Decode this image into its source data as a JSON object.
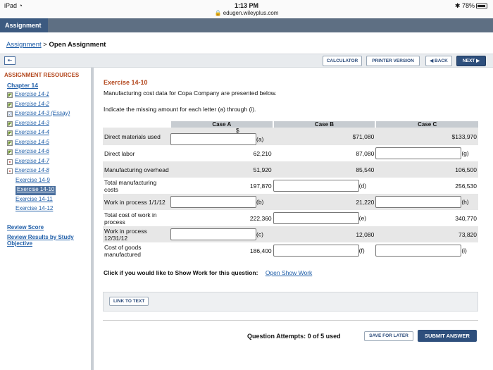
{
  "status_bar": {
    "device": "iPad",
    "wifi_icon": "wifi-icon",
    "time": "1:13 PM",
    "url": "edugen.wileyplus.com",
    "battery": "78%"
  },
  "tabs": {
    "active": "Assignment"
  },
  "breadcrumb": {
    "link": "Assignment",
    "separator": ">",
    "current": "Open Assignment"
  },
  "toolbar": {
    "calculator": "CALCULATOR",
    "printer": "PRINTER VERSION",
    "back": "◀ BACK",
    "next": "NEXT ▶"
  },
  "sidebar": {
    "header": "ASSIGNMENT RESOURCES",
    "chapter": "Chapter 14",
    "items": [
      {
        "label": "Exercise 14-1",
        "status": "partial"
      },
      {
        "label": "Exercise 14-2",
        "status": "partial"
      },
      {
        "label": "Exercise 14-3 (Essay)",
        "status": "checked"
      },
      {
        "label": "Exercise 14-3",
        "status": "partial"
      },
      {
        "label": "Exercise 14-4",
        "status": "partial"
      },
      {
        "label": "Exercise 14-5",
        "status": "partial"
      },
      {
        "label": "Exercise 14-6",
        "status": "partial"
      },
      {
        "label": "Exercise 14-7",
        "status": "wrong"
      },
      {
        "label": "Exercise 14-8",
        "status": "wrong"
      },
      {
        "label": "Exercise 14-9",
        "status": "none"
      },
      {
        "label": "Exercise 14-10",
        "status": "current"
      },
      {
        "label": "Exercise 14-11",
        "status": "none"
      },
      {
        "label": "Exercise 14-12",
        "status": "none"
      }
    ],
    "review_score": "Review Score",
    "review_results_1": "Review Results by Study",
    "review_results_2": "Objective"
  },
  "exercise": {
    "title": "Exercise 14-10",
    "intro": "Manufacturing cost data for Copa Company are presented below.",
    "instruction": "Indicate the missing amount for each letter (a) through (i).",
    "columns": [
      "Case A",
      "Case B",
      "Case C"
    ],
    "rows": [
      {
        "label": "Direct materials used",
        "a": "$",
        "a_letter": "(a)",
        "b": "$71,080",
        "c": "$133,970"
      },
      {
        "label": "Direct labor",
        "a": "62,210",
        "b": "87,080",
        "c_letter": "(g)"
      },
      {
        "label": "Manufacturing overhead",
        "a": "51,920",
        "b": "85,540",
        "c": "106,500"
      },
      {
        "label": "Total manufacturing costs",
        "a": "197,870",
        "b_letter": "(d)",
        "c": "256,530"
      },
      {
        "label": "Work in process 1/1/12",
        "a_letter": "(b)",
        "b": "21,220",
        "c_letter": "(h)"
      },
      {
        "label": "Total cost of work in process",
        "a": "222,360",
        "b_letter": "(e)",
        "c": "340,770"
      },
      {
        "label": "Work in process 12/31/12",
        "a_letter": "(c)",
        "b": "12,080",
        "c": "73,820"
      },
      {
        "label": "Cost of goods manufactured",
        "a": "186,400",
        "b_letter": "(f)",
        "c_letter": "(i)"
      }
    ],
    "show_work_prompt": "Click if you would like to Show Work for this question:",
    "show_work_link": "Open Show Work",
    "link_to_text": "LINK TO TEXT"
  },
  "footer": {
    "attempts": "Question Attempts: 0 of 5 used",
    "save_later": "SAVE FOR LATER",
    "submit": "SUBMIT ANSWER"
  }
}
